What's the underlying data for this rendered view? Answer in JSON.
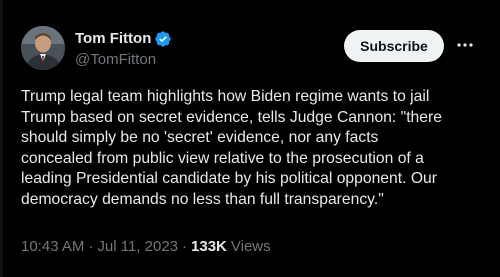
{
  "author": {
    "display_name": "Tom Fitton",
    "handle": "@TomFitton",
    "verified_icon": "verified-badge-icon",
    "verified_color": "#1d9bf0",
    "avatar_icon": "profile-photo"
  },
  "actions": {
    "subscribe_label": "Subscribe",
    "more_icon": "more-horizontal-icon"
  },
  "tweet": {
    "text": "Trump legal team highlights how Biden regime wants to jail\nTrump based on secret evidence, tells Judge Cannon: \"there\nshould simply be no 'secret' evidence, nor any facts\nconcealed from public view relative to the prosecution of a\nleading Presidential candidate by his political opponent. Our\ndemocracy demands no less than full transparency.\""
  },
  "meta": {
    "time": "10:43 AM",
    "separator": "·",
    "date": "Jul 11, 2023",
    "views_count": "133K",
    "views_label": "Views"
  },
  "colors": {
    "background": "#000000",
    "primary_text": "#e7e9ea",
    "secondary_text": "#71767b",
    "button_bg": "#eff3f4",
    "button_text": "#0f1419"
  }
}
